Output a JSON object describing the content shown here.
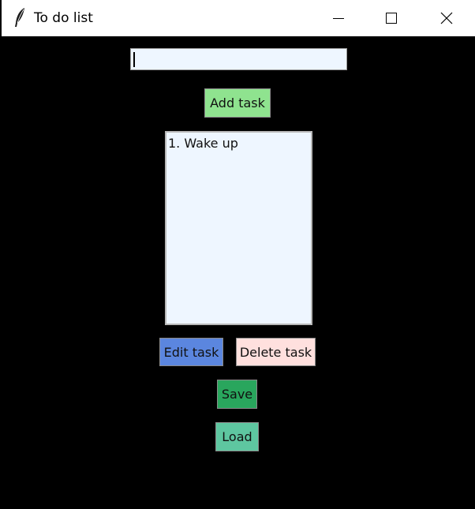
{
  "window": {
    "title": "To do list",
    "icon": "feather-icon",
    "controls": [
      "minimize-icon",
      "maximize-icon",
      "close-icon"
    ]
  },
  "task_entry": {
    "value": "",
    "placeholder": ""
  },
  "buttons": {
    "add": "Add task",
    "edit": "Edit task",
    "delete": "Delete task",
    "save": "Save",
    "load": "Load"
  },
  "tasks": [
    "1. Wake up"
  ],
  "colors": {
    "background": "#000000",
    "entry_bg": "#eef6ff",
    "add_button": "#8fe38f",
    "edit_button": "#5b86df",
    "delete_button": "#ffe0de",
    "save_button": "#29a65d",
    "load_button": "#5ec6a0"
  }
}
